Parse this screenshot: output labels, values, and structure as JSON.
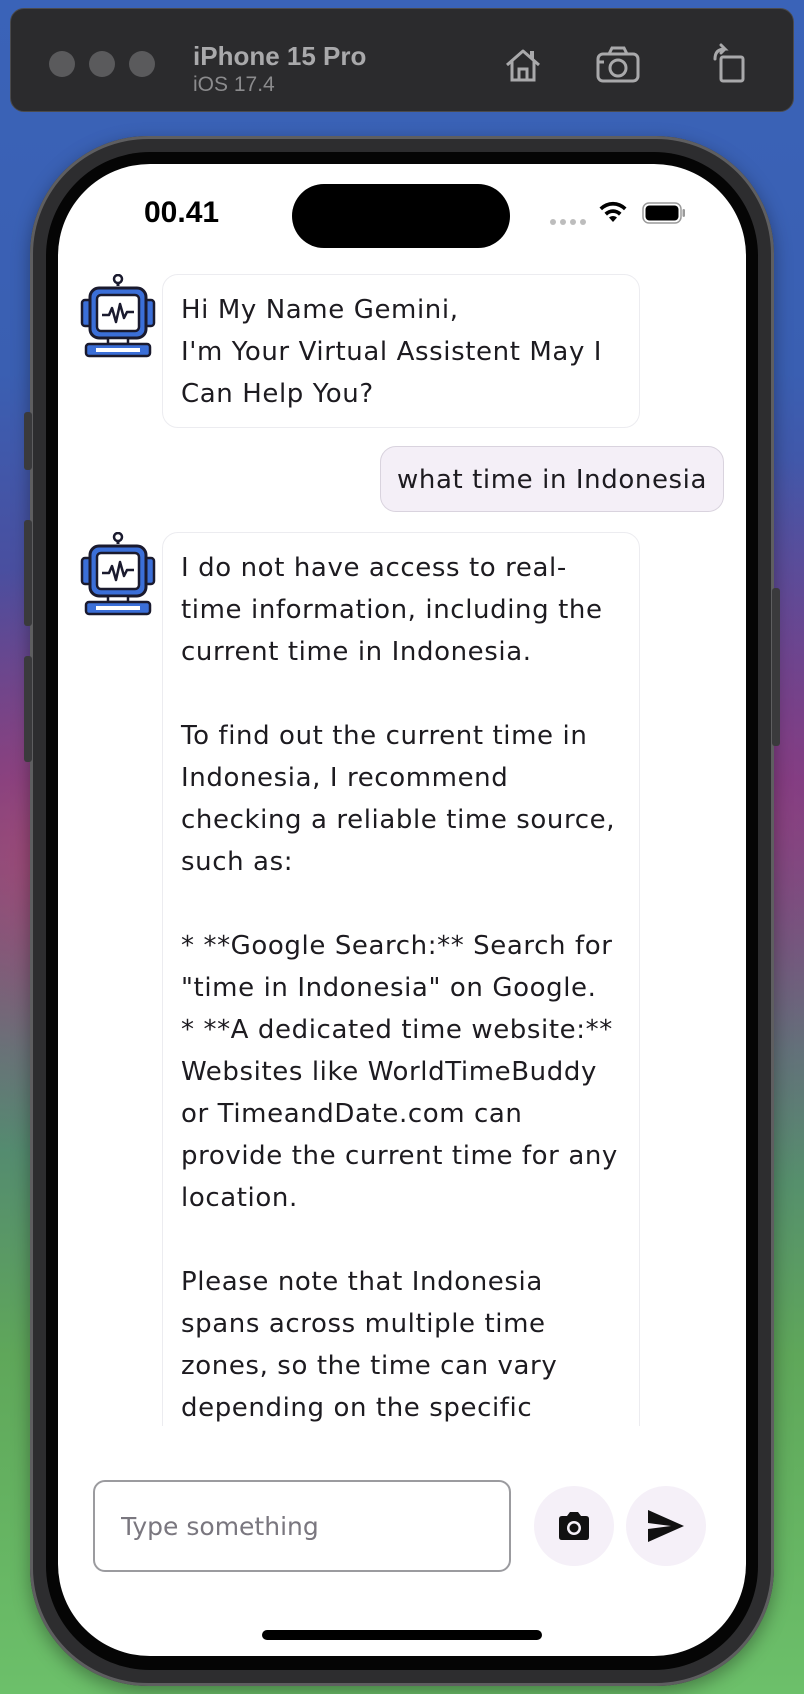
{
  "simulator": {
    "device_name": "iPhone 15 Pro",
    "os_version": "iOS 17.4",
    "icons": [
      "home-icon",
      "screenshot-icon",
      "rotate-icon"
    ]
  },
  "status_bar": {
    "time": "00.41",
    "icons": [
      "cellular-dots-icon",
      "wifi-icon",
      "battery-icon"
    ]
  },
  "chat": {
    "messages": [
      {
        "role": "bot",
        "text": "Hi My Name Gemini,\nI'm Your Virtual Assistent May I Can Help You?"
      },
      {
        "role": "user",
        "text": "what time in Indonesia"
      },
      {
        "role": "bot",
        "text": "I do not have access to real-time information, including the current time in Indonesia.\n\nTo find out the current time in Indonesia, I recommend checking a reliable time source, such as:\n\n* **Google Search:** Search for \"time in Indonesia\" on Google.\n* **A dedicated time website:** Websites like WorldTimeBuddy or TimeandDate.com can provide the current time for any location.\n\nPlease note that Indonesia spans across multiple time zones, so the time can vary depending on the specific"
      }
    ]
  },
  "composer": {
    "placeholder": "Type something",
    "value": "",
    "icons": [
      "camera-icon",
      "send-icon"
    ]
  }
}
